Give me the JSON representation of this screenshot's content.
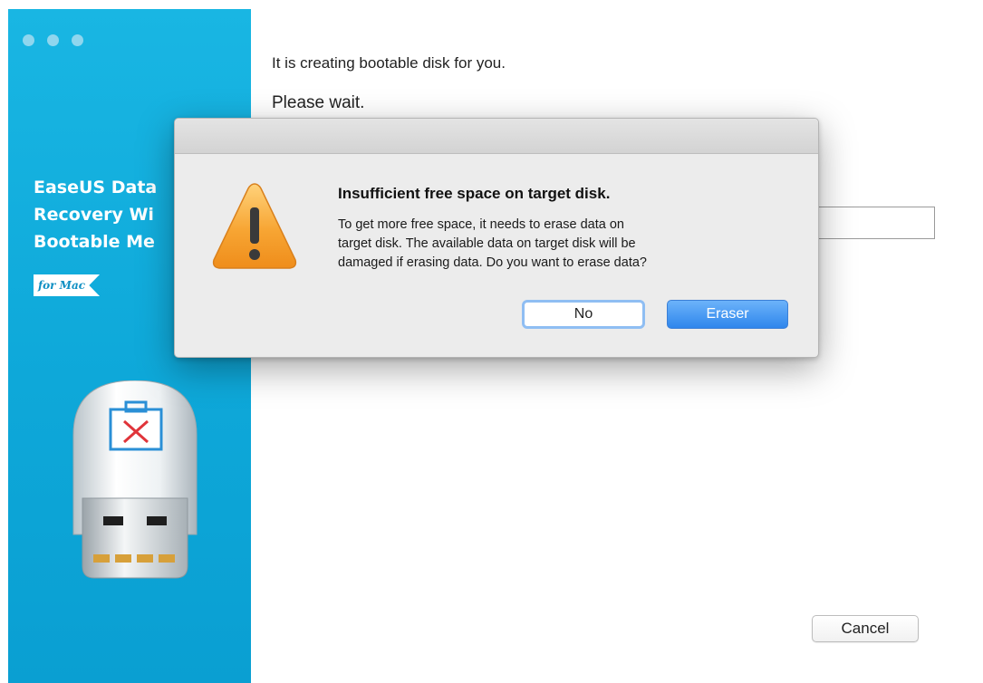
{
  "sidebar": {
    "brand_lines": [
      "EaseUS Data",
      "Recovery Wi",
      "Bootable Me"
    ],
    "badge": "for Mac",
    "color": "#14b0df"
  },
  "main": {
    "status_line": "It is creating bootable disk for you.",
    "wait_line": "Please wait.",
    "cancel_label": "Cancel"
  },
  "dialog": {
    "icon": "warning-icon",
    "title": "Insufficient free space on target disk.",
    "message_lines": [
      "To get more free space, it needs to erase data on",
      "target disk. The available data on target disk will be",
      "damaged if erasing data. Do you want to erase data?"
    ],
    "no_label": "No",
    "eraser_label": "Eraser",
    "accent_color": "#3d8ff0"
  }
}
